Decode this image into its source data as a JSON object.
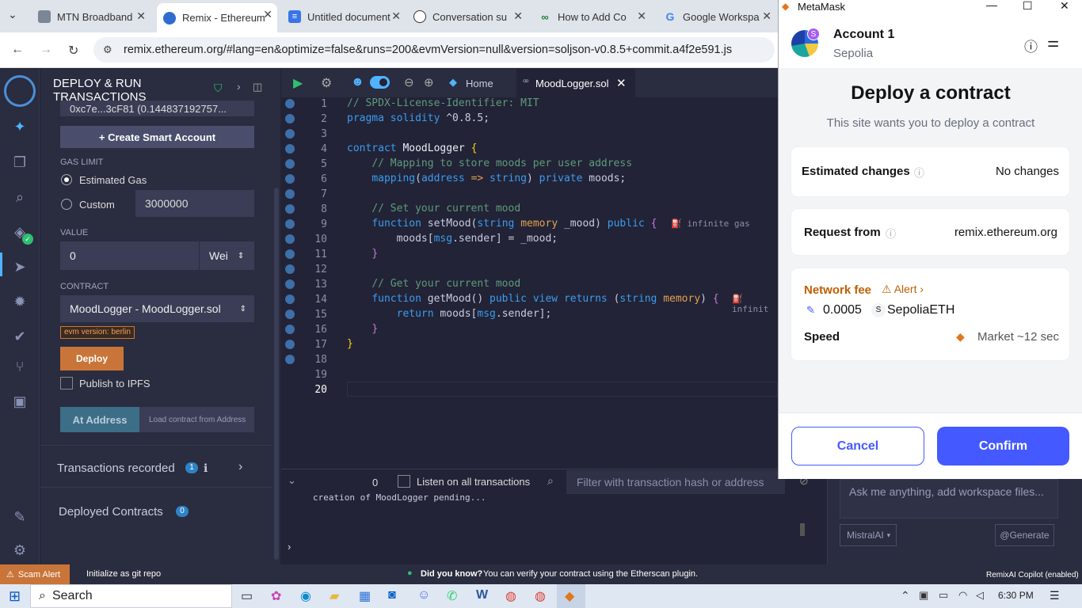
{
  "browser": {
    "tabs": [
      {
        "label": "MTN Broadband",
        "color": "#7b8696"
      },
      {
        "label": "Remix - Ethereum",
        "color": "#2f6bd1"
      },
      {
        "label": "Untitled document",
        "color": "#3a74e6"
      },
      {
        "label": "Conversation su",
        "color": "#333333"
      },
      {
        "label": "How to Add Co",
        "color": "#188038"
      },
      {
        "label": "Google Workspa",
        "color": "#4285f4"
      }
    ],
    "url": "remix.ethereum.org/#lang=en&optimize=false&runs=200&evmVersion=null&version=soljson-v0.8.5+commit.a4f2e591.js"
  },
  "panel": {
    "title_line1": "DEPLOY & RUN",
    "title_line2": "TRANSACTIONS",
    "account_value": "0xc7e...3cF81 (0.144837192757...",
    "create_smart_account": "+ Create Smart Account",
    "gas_limit_label": "GAS LIMIT",
    "estimated_gas": "Estimated Gas",
    "custom": "Custom",
    "custom_value": "3000000",
    "value_label": "VALUE",
    "value_amount": "0",
    "value_unit": "Wei",
    "contract_label": "CONTRACT",
    "contract_value": "MoodLogger - MoodLogger.sol",
    "evm_badge": "evm version: berlin",
    "deploy": "Deploy",
    "publish_ipfs": "Publish to IPFS",
    "at_address": "At Address",
    "load_placeholder": "Load contract from Address",
    "transactions_recorded": "Transactions recorded",
    "transactions_count": "1",
    "deployed_contracts": "Deployed Contracts",
    "deployed_count": "0"
  },
  "editor": {
    "home_tab": "Home",
    "file_tab": "MoodLogger.sol",
    "gas_hint": "infinite gas",
    "gas_hint_short": "infinit",
    "lines": [
      "1",
      "2",
      "3",
      "4",
      "5",
      "6",
      "7",
      "8",
      "9",
      "10",
      "11",
      "12",
      "13",
      "14",
      "15",
      "16",
      "17",
      "18",
      "19",
      "20"
    ]
  },
  "terminal": {
    "count": "0",
    "listen_label": "Listen on all transactions",
    "filter_placeholder": "Filter with transaction hash or address",
    "log": "creation of MoodLogger pending..."
  },
  "status": {
    "scam_alert": "Scam Alert",
    "git": "Initialize as git repo",
    "did_you_know": "Did you know?",
    "tip": "You can verify your contract using the Etherscan plugin.",
    "copilot": "RemixAI Copilot (enabled)"
  },
  "copilot": {
    "placeholder": "Ask me anything, add workspace files...",
    "model": "MistralAI",
    "generate": "@Generate"
  },
  "metamask": {
    "window_title": "MetaMask",
    "account": "Account 1",
    "network": "Sepolia",
    "avatar_letter": "S",
    "heading": "Deploy a contract",
    "subheading": "This site wants you to deploy a contract",
    "estimated_changes": "Estimated changes",
    "no_changes": "No changes",
    "request_from": "Request from",
    "origin": "remix.ethereum.org",
    "network_fee": "Network fee",
    "alert": "Alert",
    "fee_value": "0.0005",
    "fee_symbol_letter": "S",
    "fee_currency": "SepoliaETH",
    "speed": "Speed",
    "speed_value": "Market ~12 sec",
    "cancel": "Cancel",
    "confirm": "Confirm"
  },
  "taskbar": {
    "search": "Search",
    "time": "6:30 PM"
  },
  "colors": {
    "accent": "#4459ff",
    "deploy": "#c97539",
    "metamask_blue": "#4459ff",
    "alert": "#bf5e00"
  }
}
